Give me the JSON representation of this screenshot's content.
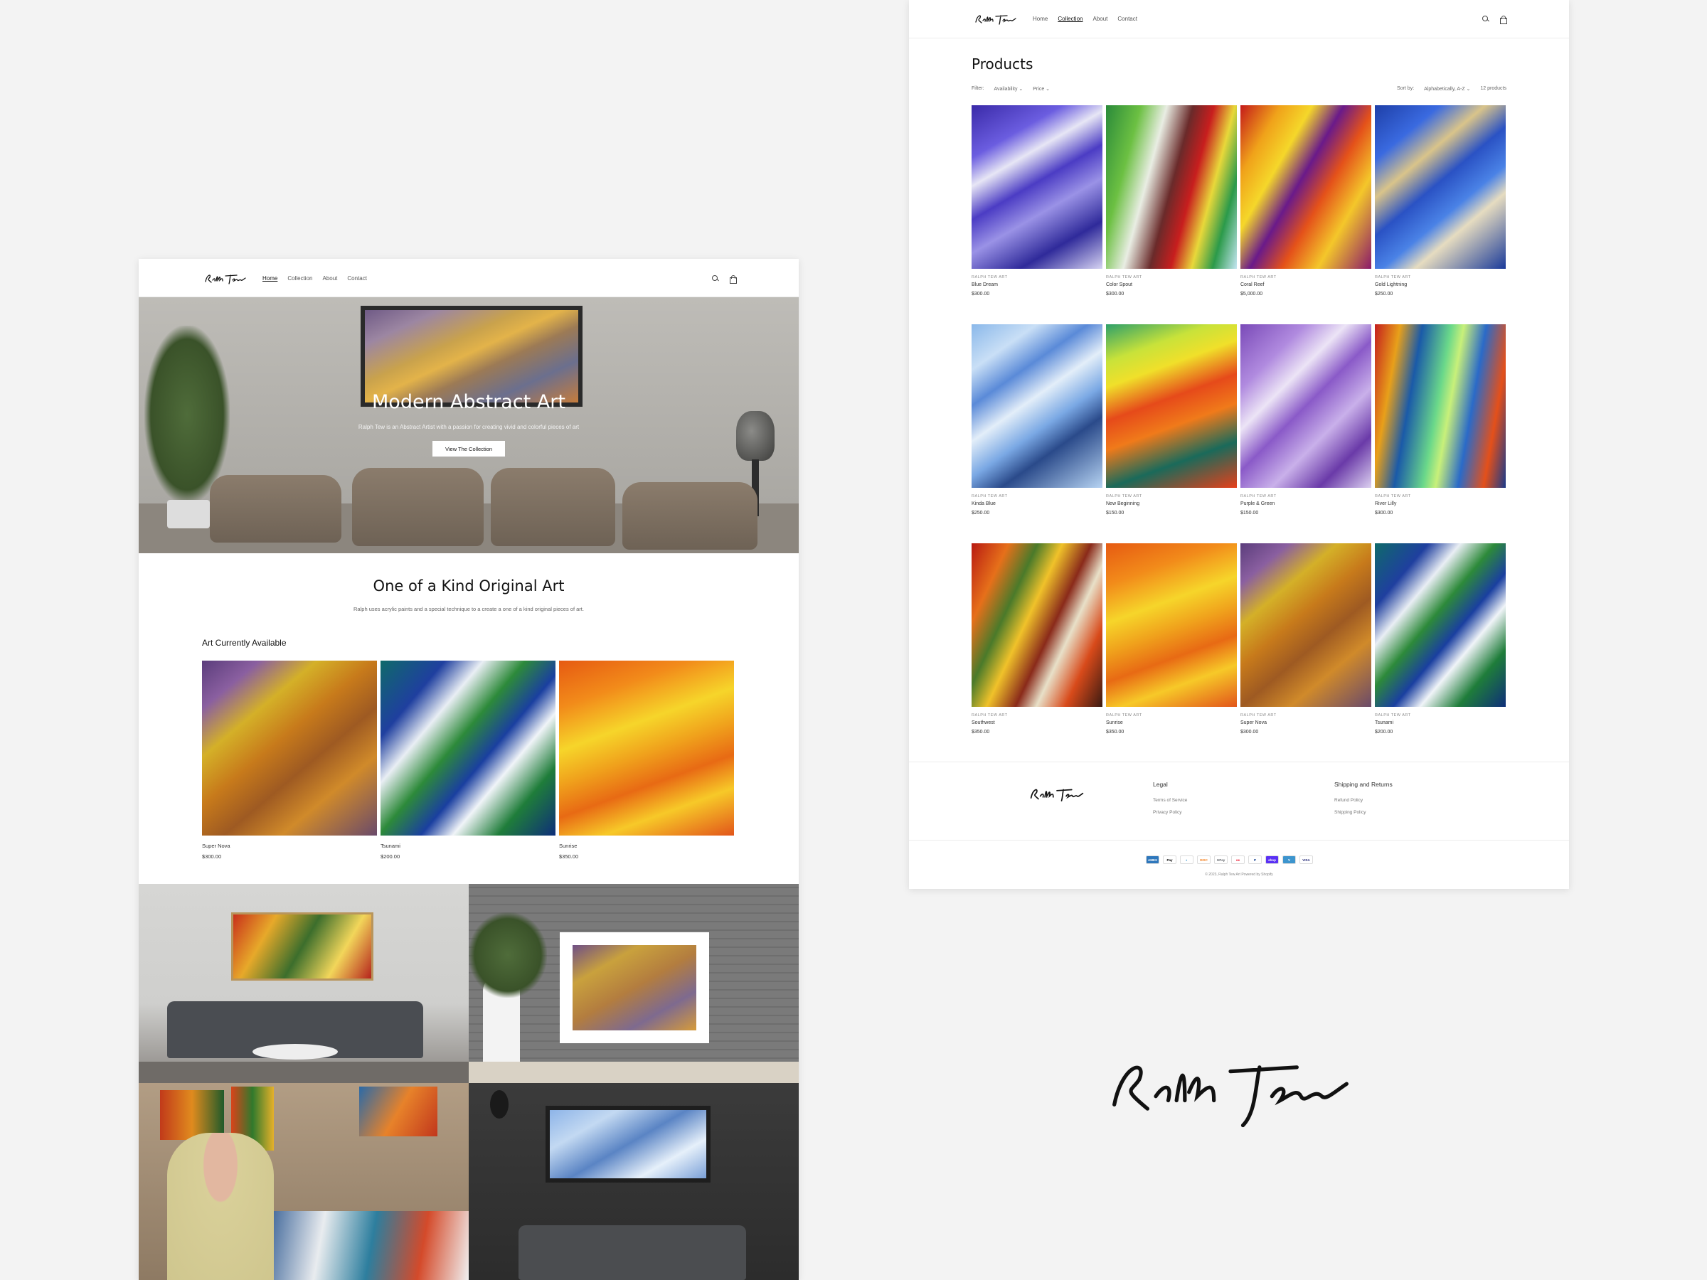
{
  "logo_text": "Ralph Tew",
  "home_page": {
    "nav": [
      "Home",
      "Collection",
      "About",
      "Contact"
    ],
    "hero": {
      "title": "Modern Abstract Art",
      "subtitle": "Ralph Tew is an Abstract Artist with a passion for creating vivid and colorful pieces of art",
      "button": "View The Collection"
    },
    "intro": {
      "title": "One of a Kind Original Art",
      "text": "Ralph uses acrylic paints and a special technique to a create a one of a kind original pieces of art."
    },
    "featured": {
      "title": "Art Currently Available",
      "items": [
        {
          "name": "Super Nova",
          "price": "$300.00"
        },
        {
          "name": "Tsunami",
          "price": "$200.00"
        },
        {
          "name": "Sunrise",
          "price": "$350.00"
        }
      ]
    }
  },
  "products_page": {
    "nav": [
      "Home",
      "Collection",
      "About",
      "Contact"
    ],
    "title": "Products",
    "filter_label": "Filter:",
    "filters": [
      "Availability",
      "Price"
    ],
    "sort_label": "Sort by:",
    "sort_value": "Alphabetically, A-Z",
    "count": "12 products",
    "vendor": "RALPH TEW ART",
    "products": [
      {
        "name": "Blue Dream",
        "price": "$300.00"
      },
      {
        "name": "Color Spout",
        "price": "$300.00"
      },
      {
        "name": "Coral Reef",
        "price": "$5,000.00"
      },
      {
        "name": "Gold Lightning",
        "price": "$250.00"
      },
      {
        "name": "Kinda Blue",
        "price": "$250.00"
      },
      {
        "name": "New Beginning",
        "price": "$150.00"
      },
      {
        "name": "Purple & Green",
        "price": "$150.00"
      },
      {
        "name": "River Lilly",
        "price": "$300.00"
      },
      {
        "name": "Southwest",
        "price": "$350.00"
      },
      {
        "name": "Sunrise",
        "price": "$350.00"
      },
      {
        "name": "Super Nova",
        "price": "$300.00"
      },
      {
        "name": "Tsunami",
        "price": "$200.00"
      }
    ],
    "footer": {
      "legal_title": "Legal",
      "legal_links": [
        "Terms of Service",
        "Privacy Policy"
      ],
      "shipping_title": "Shipping and Returns",
      "shipping_links": [
        "Refund Policy",
        "Shipping Policy"
      ],
      "payment_icons": [
        "American Express",
        "Apple Pay",
        "Diners Club",
        "Discover",
        "Google Pay",
        "Mastercard",
        "PayPal",
        "Shop Pay",
        "Venmo",
        "Visa"
      ],
      "copyright": "© 2023, Ralph Tew Art Powered by Shopify"
    }
  },
  "colors": {
    "background": "#f3f3f3",
    "text": "#121212",
    "muted": "#777777"
  }
}
